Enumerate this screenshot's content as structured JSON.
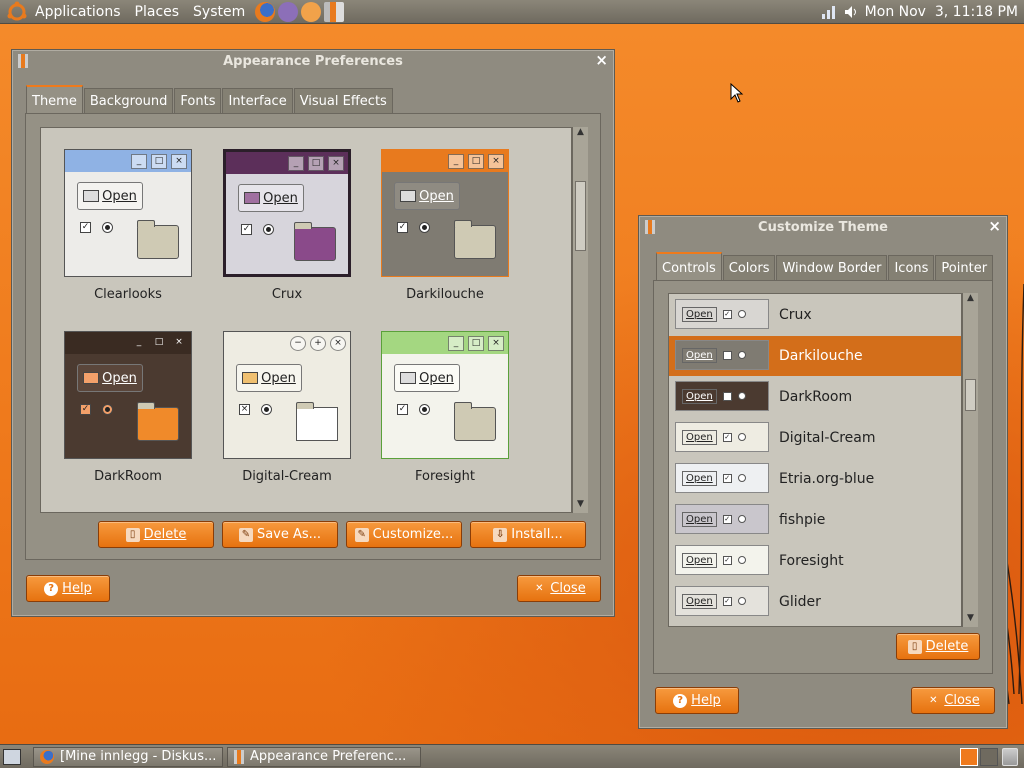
{
  "top_panel": {
    "menus": [
      "Applications",
      "Places",
      "System"
    ],
    "clock": "Mon Nov  3, 11:18 PM"
  },
  "appearance_window": {
    "title": "Appearance Preferences",
    "tabs": [
      "Theme",
      "Background",
      "Fonts",
      "Interface",
      "Visual Effects"
    ],
    "active_tab": "Theme",
    "themes": [
      {
        "name": "Clearlooks",
        "open_label": "Open",
        "titlebar": "#8fb2e4",
        "body": "#edece9"
      },
      {
        "name": "Crux",
        "open_label": "Open",
        "titlebar": "#5c2f5a",
        "body": "#d7d5dc"
      },
      {
        "name": "Darkilouche",
        "open_label": "Open",
        "titlebar": "#e87a1e",
        "body": "#7f7b72"
      },
      {
        "name": "DarkRoom",
        "open_label": "Open",
        "titlebar": "#3a2b22",
        "body": "#4b3a30"
      },
      {
        "name": "Digital-Cream",
        "open_label": "Open",
        "titlebar": "#eeece2",
        "body": "#eeece2"
      },
      {
        "name": "Foresight",
        "open_label": "Open",
        "titlebar": "#a4d781",
        "body": "#f3f3ec"
      }
    ],
    "actions": {
      "delete": "Delete",
      "save_as": "Save As...",
      "customize": "Customize...",
      "install": "Install..."
    },
    "help": "Help",
    "close": "Close"
  },
  "customize_window": {
    "title": "Customize Theme",
    "tabs": [
      "Controls",
      "Colors",
      "Window Border",
      "Icons",
      "Pointer"
    ],
    "active_tab": "Controls",
    "items": [
      {
        "name": "Crux",
        "open_label": "Open",
        "bg": "#d8d6d2",
        "selected": false
      },
      {
        "name": "Darkilouche",
        "open_label": "Open",
        "bg": "#7f7b72",
        "selected": true
      },
      {
        "name": "DarkRoom",
        "open_label": "Open",
        "bg": "#4b3a30",
        "selected": false
      },
      {
        "name": "Digital-Cream",
        "open_label": "Open",
        "bg": "#eeece2",
        "selected": false
      },
      {
        "name": "Etria.org-blue",
        "open_label": "Open",
        "bg": "#eef0f2",
        "selected": false
      },
      {
        "name": "fishpie",
        "open_label": "Open",
        "bg": "#c9c6cc",
        "selected": false
      },
      {
        "name": "Foresight",
        "open_label": "Open",
        "bg": "#f3f3ec",
        "selected": false
      },
      {
        "name": "Glider",
        "open_label": "Open",
        "bg": "#e4e2dc",
        "selected": false
      }
    ],
    "delete": "Delete",
    "help": "Help",
    "close": "Close"
  },
  "taskbar": {
    "tasks": [
      "[Mine innlegg - Diskus...",
      "Appearance Preferenc..."
    ]
  },
  "colors": {
    "accent": "#ef7a1c",
    "panel": "#7c776c",
    "window": "#8f8b80"
  }
}
